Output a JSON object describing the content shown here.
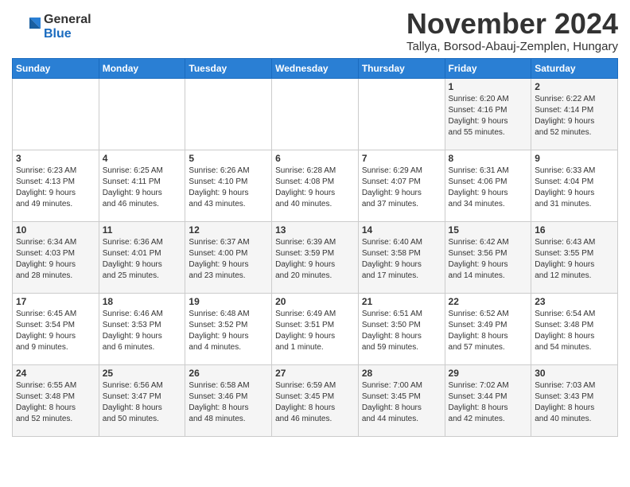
{
  "logo": {
    "general": "General",
    "blue": "Blue"
  },
  "title": "November 2024",
  "subtitle": "Tallya, Borsod-Abauj-Zemplen, Hungary",
  "days_of_week": [
    "Sunday",
    "Monday",
    "Tuesday",
    "Wednesday",
    "Thursday",
    "Friday",
    "Saturday"
  ],
  "weeks": [
    [
      {
        "day": "",
        "info": ""
      },
      {
        "day": "",
        "info": ""
      },
      {
        "day": "",
        "info": ""
      },
      {
        "day": "",
        "info": ""
      },
      {
        "day": "",
        "info": ""
      },
      {
        "day": "1",
        "info": "Sunrise: 6:20 AM\nSunset: 4:16 PM\nDaylight: 9 hours\nand 55 minutes."
      },
      {
        "day": "2",
        "info": "Sunrise: 6:22 AM\nSunset: 4:14 PM\nDaylight: 9 hours\nand 52 minutes."
      }
    ],
    [
      {
        "day": "3",
        "info": "Sunrise: 6:23 AM\nSunset: 4:13 PM\nDaylight: 9 hours\nand 49 minutes."
      },
      {
        "day": "4",
        "info": "Sunrise: 6:25 AM\nSunset: 4:11 PM\nDaylight: 9 hours\nand 46 minutes."
      },
      {
        "day": "5",
        "info": "Sunrise: 6:26 AM\nSunset: 4:10 PM\nDaylight: 9 hours\nand 43 minutes."
      },
      {
        "day": "6",
        "info": "Sunrise: 6:28 AM\nSunset: 4:08 PM\nDaylight: 9 hours\nand 40 minutes."
      },
      {
        "day": "7",
        "info": "Sunrise: 6:29 AM\nSunset: 4:07 PM\nDaylight: 9 hours\nand 37 minutes."
      },
      {
        "day": "8",
        "info": "Sunrise: 6:31 AM\nSunset: 4:06 PM\nDaylight: 9 hours\nand 34 minutes."
      },
      {
        "day": "9",
        "info": "Sunrise: 6:33 AM\nSunset: 4:04 PM\nDaylight: 9 hours\nand 31 minutes."
      }
    ],
    [
      {
        "day": "10",
        "info": "Sunrise: 6:34 AM\nSunset: 4:03 PM\nDaylight: 9 hours\nand 28 minutes."
      },
      {
        "day": "11",
        "info": "Sunrise: 6:36 AM\nSunset: 4:01 PM\nDaylight: 9 hours\nand 25 minutes."
      },
      {
        "day": "12",
        "info": "Sunrise: 6:37 AM\nSunset: 4:00 PM\nDaylight: 9 hours\nand 23 minutes."
      },
      {
        "day": "13",
        "info": "Sunrise: 6:39 AM\nSunset: 3:59 PM\nDaylight: 9 hours\nand 20 minutes."
      },
      {
        "day": "14",
        "info": "Sunrise: 6:40 AM\nSunset: 3:58 PM\nDaylight: 9 hours\nand 17 minutes."
      },
      {
        "day": "15",
        "info": "Sunrise: 6:42 AM\nSunset: 3:56 PM\nDaylight: 9 hours\nand 14 minutes."
      },
      {
        "day": "16",
        "info": "Sunrise: 6:43 AM\nSunset: 3:55 PM\nDaylight: 9 hours\nand 12 minutes."
      }
    ],
    [
      {
        "day": "17",
        "info": "Sunrise: 6:45 AM\nSunset: 3:54 PM\nDaylight: 9 hours\nand 9 minutes."
      },
      {
        "day": "18",
        "info": "Sunrise: 6:46 AM\nSunset: 3:53 PM\nDaylight: 9 hours\nand 6 minutes."
      },
      {
        "day": "19",
        "info": "Sunrise: 6:48 AM\nSunset: 3:52 PM\nDaylight: 9 hours\nand 4 minutes."
      },
      {
        "day": "20",
        "info": "Sunrise: 6:49 AM\nSunset: 3:51 PM\nDaylight: 9 hours\nand 1 minute."
      },
      {
        "day": "21",
        "info": "Sunrise: 6:51 AM\nSunset: 3:50 PM\nDaylight: 8 hours\nand 59 minutes."
      },
      {
        "day": "22",
        "info": "Sunrise: 6:52 AM\nSunset: 3:49 PM\nDaylight: 8 hours\nand 57 minutes."
      },
      {
        "day": "23",
        "info": "Sunrise: 6:54 AM\nSunset: 3:48 PM\nDaylight: 8 hours\nand 54 minutes."
      }
    ],
    [
      {
        "day": "24",
        "info": "Sunrise: 6:55 AM\nSunset: 3:48 PM\nDaylight: 8 hours\nand 52 minutes."
      },
      {
        "day": "25",
        "info": "Sunrise: 6:56 AM\nSunset: 3:47 PM\nDaylight: 8 hours\nand 50 minutes."
      },
      {
        "day": "26",
        "info": "Sunrise: 6:58 AM\nSunset: 3:46 PM\nDaylight: 8 hours\nand 48 minutes."
      },
      {
        "day": "27",
        "info": "Sunrise: 6:59 AM\nSunset: 3:45 PM\nDaylight: 8 hours\nand 46 minutes."
      },
      {
        "day": "28",
        "info": "Sunrise: 7:00 AM\nSunset: 3:45 PM\nDaylight: 8 hours\nand 44 minutes."
      },
      {
        "day": "29",
        "info": "Sunrise: 7:02 AM\nSunset: 3:44 PM\nDaylight: 8 hours\nand 42 minutes."
      },
      {
        "day": "30",
        "info": "Sunrise: 7:03 AM\nSunset: 3:43 PM\nDaylight: 8 hours\nand 40 minutes."
      }
    ]
  ]
}
